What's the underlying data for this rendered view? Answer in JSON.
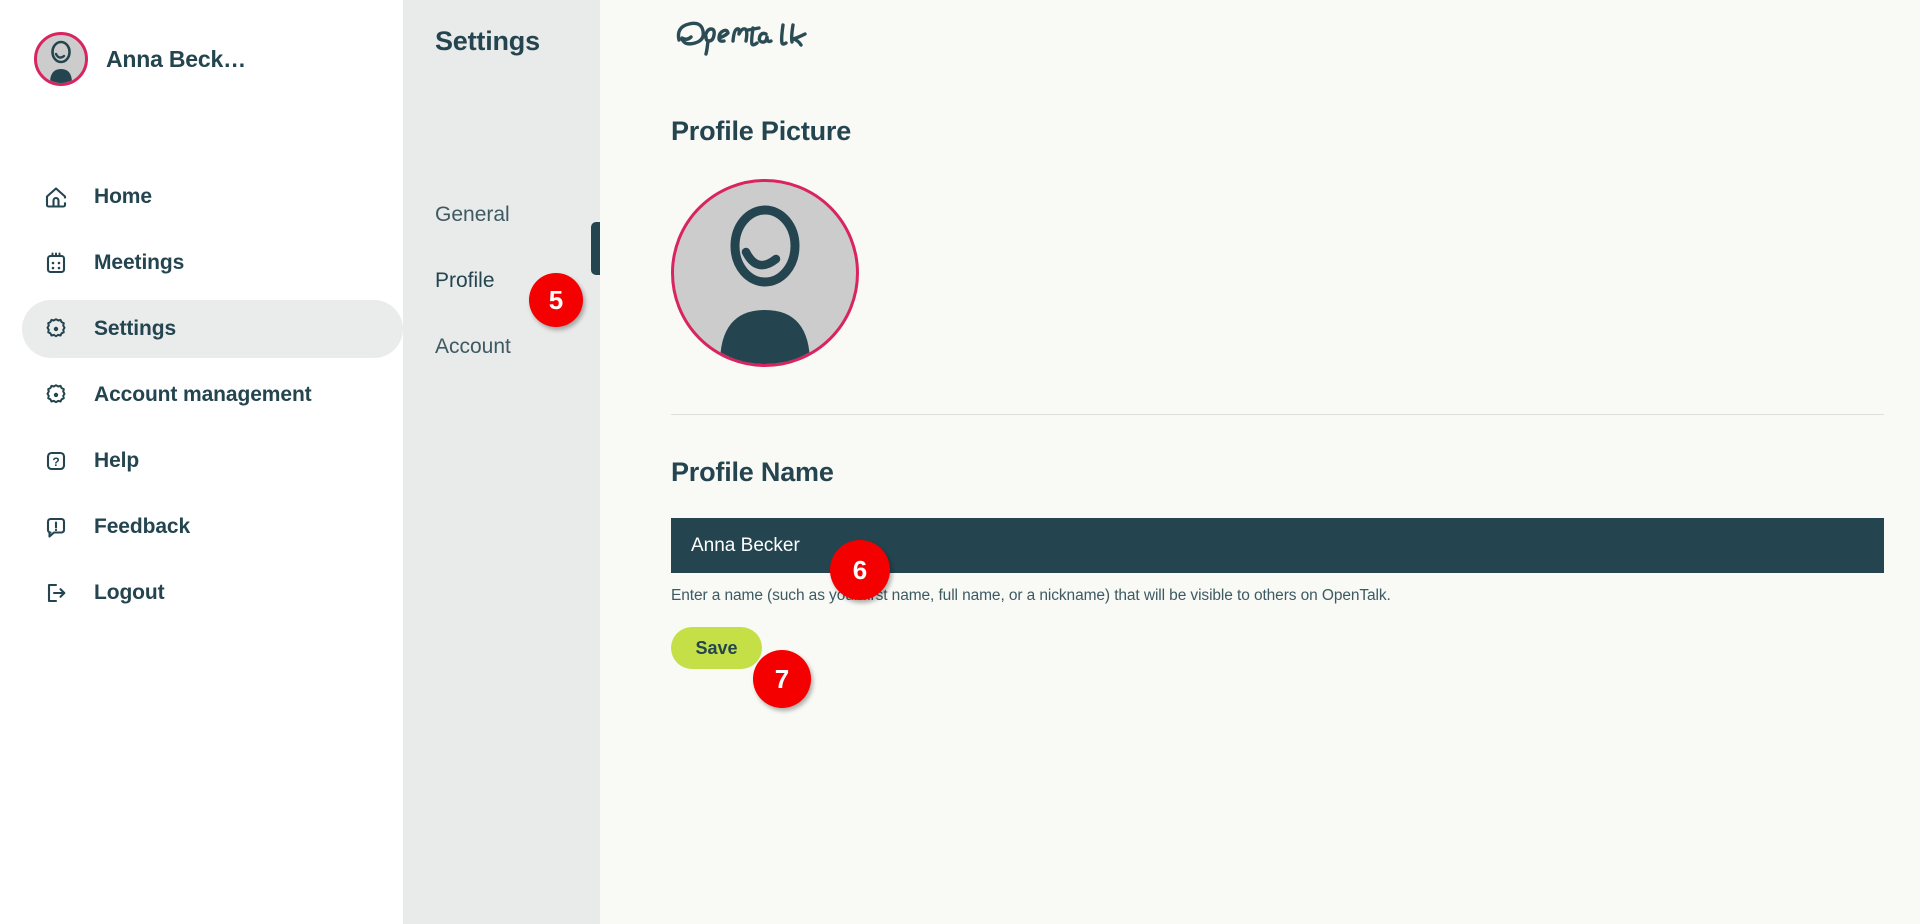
{
  "app": {
    "name": "OpenTalk",
    "logo_text": "Opentalk"
  },
  "sidebar": {
    "user": {
      "name": "Anna Beck…",
      "avatar_icon": "user-avatar-icon"
    },
    "items": [
      {
        "label": "Home",
        "icon": "home-icon",
        "active": false
      },
      {
        "label": "Meetings",
        "icon": "calendar-icon",
        "active": false
      },
      {
        "label": "Settings",
        "icon": "gear-icon",
        "active": true
      },
      {
        "label": "Account management",
        "icon": "gear-icon",
        "active": false
      },
      {
        "label": "Help",
        "icon": "question-box-icon",
        "active": false
      },
      {
        "label": "Feedback",
        "icon": "speech-bubble-alert-icon",
        "active": false
      },
      {
        "label": "Logout",
        "icon": "logout-arrow-icon",
        "active": false
      }
    ]
  },
  "settings_panel": {
    "title": "Settings",
    "links": [
      {
        "label": "General",
        "active": false
      },
      {
        "label": "Profile",
        "active": true
      },
      {
        "label": "Account",
        "active": false
      }
    ]
  },
  "main": {
    "profile_picture": {
      "heading": "Profile Picture",
      "avatar_icon": "user-avatar-large-icon"
    },
    "profile_name": {
      "heading": "Profile Name",
      "value": "Anna Becker",
      "placeholder": "Profile Name",
      "helper": "Enter a name (such as your first name, full name, or a nickname) that will be visible to others on OpenTalk.",
      "save_label": "Save"
    }
  },
  "step_badges": [
    {
      "number": "5",
      "target": "settings-link-profile"
    },
    {
      "number": "6",
      "target": "profile-name-input"
    },
    {
      "number": "7",
      "target": "save-button"
    }
  ],
  "colors": {
    "accent_dark": "#24454f",
    "accent_lime": "#c5e047",
    "accent_pink": "#d8245f",
    "badge_red": "#f50000",
    "panel_grey": "#e9eaea",
    "content_bg": "#f9f9f5"
  }
}
